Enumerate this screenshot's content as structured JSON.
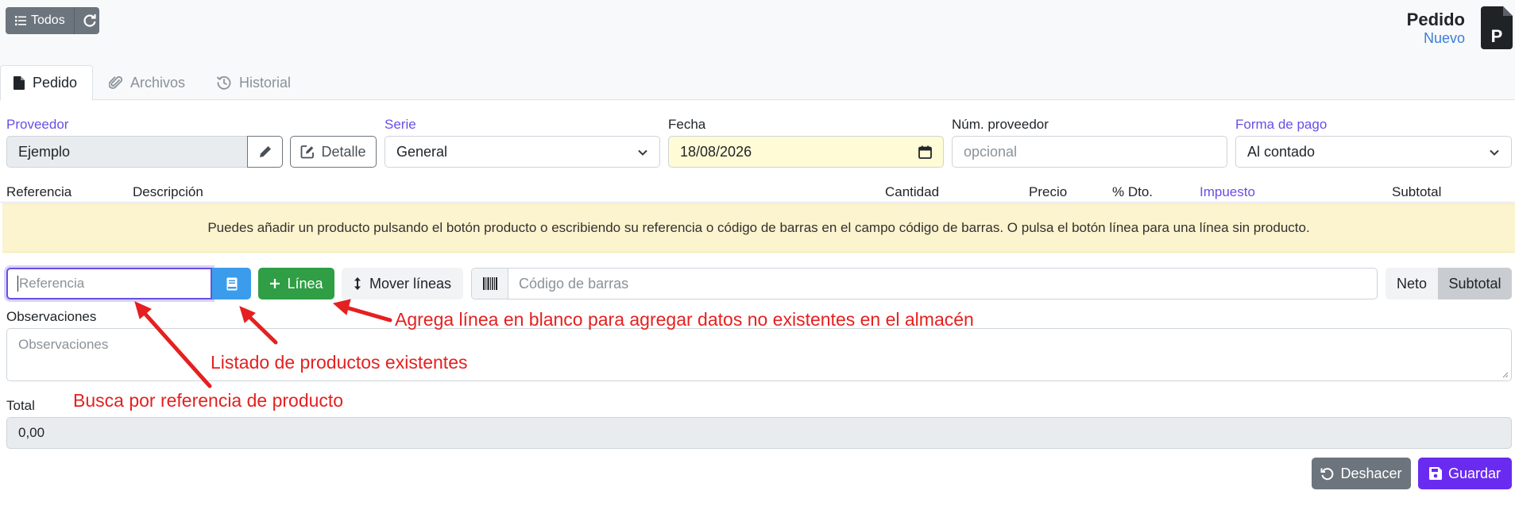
{
  "topbar": {
    "todos_label": "Todos",
    "doc_title": "Pedido",
    "doc_status": "Nuevo",
    "doc_icon_letter": "P"
  },
  "tabs": [
    {
      "label": "Pedido",
      "icon": "file-icon",
      "active": true
    },
    {
      "label": "Archivos",
      "icon": "paperclip-icon",
      "active": false
    },
    {
      "label": "Historial",
      "icon": "history-icon",
      "active": false
    }
  ],
  "form": {
    "proveedor_label": "Proveedor",
    "proveedor_value": "Ejemplo",
    "detalle_label": "Detalle",
    "serie_label": "Serie",
    "serie_value": "General",
    "fecha_label": "Fecha",
    "fecha_value": "18/08/2026",
    "num_proveedor_label": "Núm. proveedor",
    "num_proveedor_placeholder": "opcional",
    "forma_pago_label": "Forma de pago",
    "forma_pago_value": "Al contado"
  },
  "lines_header": {
    "referencia": "Referencia",
    "descripcion": "Descripción",
    "cantidad": "Cantidad",
    "precio": "Precio",
    "dto": "% Dto.",
    "impuesto": "Impuesto",
    "subtotal": "Subtotal"
  },
  "alert_text": "Puedes añadir un producto pulsando el botón producto o escribiendo su referencia o código de barras en el campo código de barras. O pulsa el botón línea para una línea sin producto.",
  "toolbar": {
    "referencia_placeholder": "Referencia",
    "linea_label": "Línea",
    "mover_label": "Mover líneas",
    "barcode_placeholder": "Código de barras",
    "neto_label": "Neto",
    "subtotal_label": "Subtotal"
  },
  "observaciones": {
    "label": "Observaciones",
    "placeholder": "Observaciones"
  },
  "total": {
    "label": "Total",
    "value": "0,00"
  },
  "actions": {
    "deshacer_label": "Deshacer",
    "guardar_label": "Guardar"
  },
  "annotations": {
    "linea_note": "Agrega línea en blanco para agregar datos no existentes en el almacén",
    "listado_note": "Listado de productos existentes",
    "busca_note": "Busca por referencia de producto"
  },
  "colors": {
    "link": "#6a4ee6",
    "primary": "#6a2bf0",
    "success": "#2f9e44",
    "info": "#3c9cec",
    "warning_bg": "#fcf3cf",
    "annotation": "#e52020"
  }
}
